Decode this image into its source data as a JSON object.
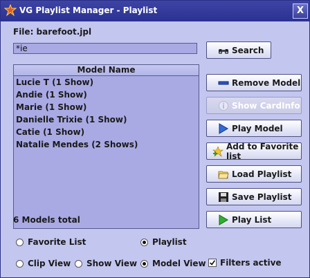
{
  "window": {
    "title": "VG Playlist Manager - Playlist",
    "close_glyph": "X"
  },
  "file": {
    "label": "File: barefoot.jpl"
  },
  "search": {
    "value": "*ie",
    "button_label": "Search"
  },
  "list": {
    "header": "Model Name",
    "items": [
      "Lucie T (1 Show)",
      "Andie (1 Show)",
      "Marie (1 Show)",
      "Danielle Trixie (1 Show)",
      "Catie (1 Show)",
      "Natalie Mendes (2 Shows)"
    ],
    "total": "6 Models total"
  },
  "buttons": {
    "remove_model": "Remove Model",
    "show_cardinfo": "Show CardInfo",
    "play_model": "Play Model",
    "add_favorite": "Add to Favorite list",
    "load_playlist": "Load Playlist",
    "save_playlist": "Save Playlist",
    "play_list": "Play List"
  },
  "source_options": {
    "favorite": "Favorite List",
    "playlist": "Playlist",
    "selected": "Playlist"
  },
  "view_options": {
    "clip": "Clip View",
    "show": "Show View",
    "model": "Model View",
    "selected": "Model View"
  },
  "filters": {
    "label": "Filters active",
    "checked": true
  },
  "icons": [
    "app-icon",
    "binoculars-icon",
    "remove-icon",
    "cardinfo-icon",
    "play-icon",
    "add-favorite-icon",
    "folder-open-icon",
    "floppy-save-icon",
    "play-green-icon",
    "checkmark-icon"
  ]
}
